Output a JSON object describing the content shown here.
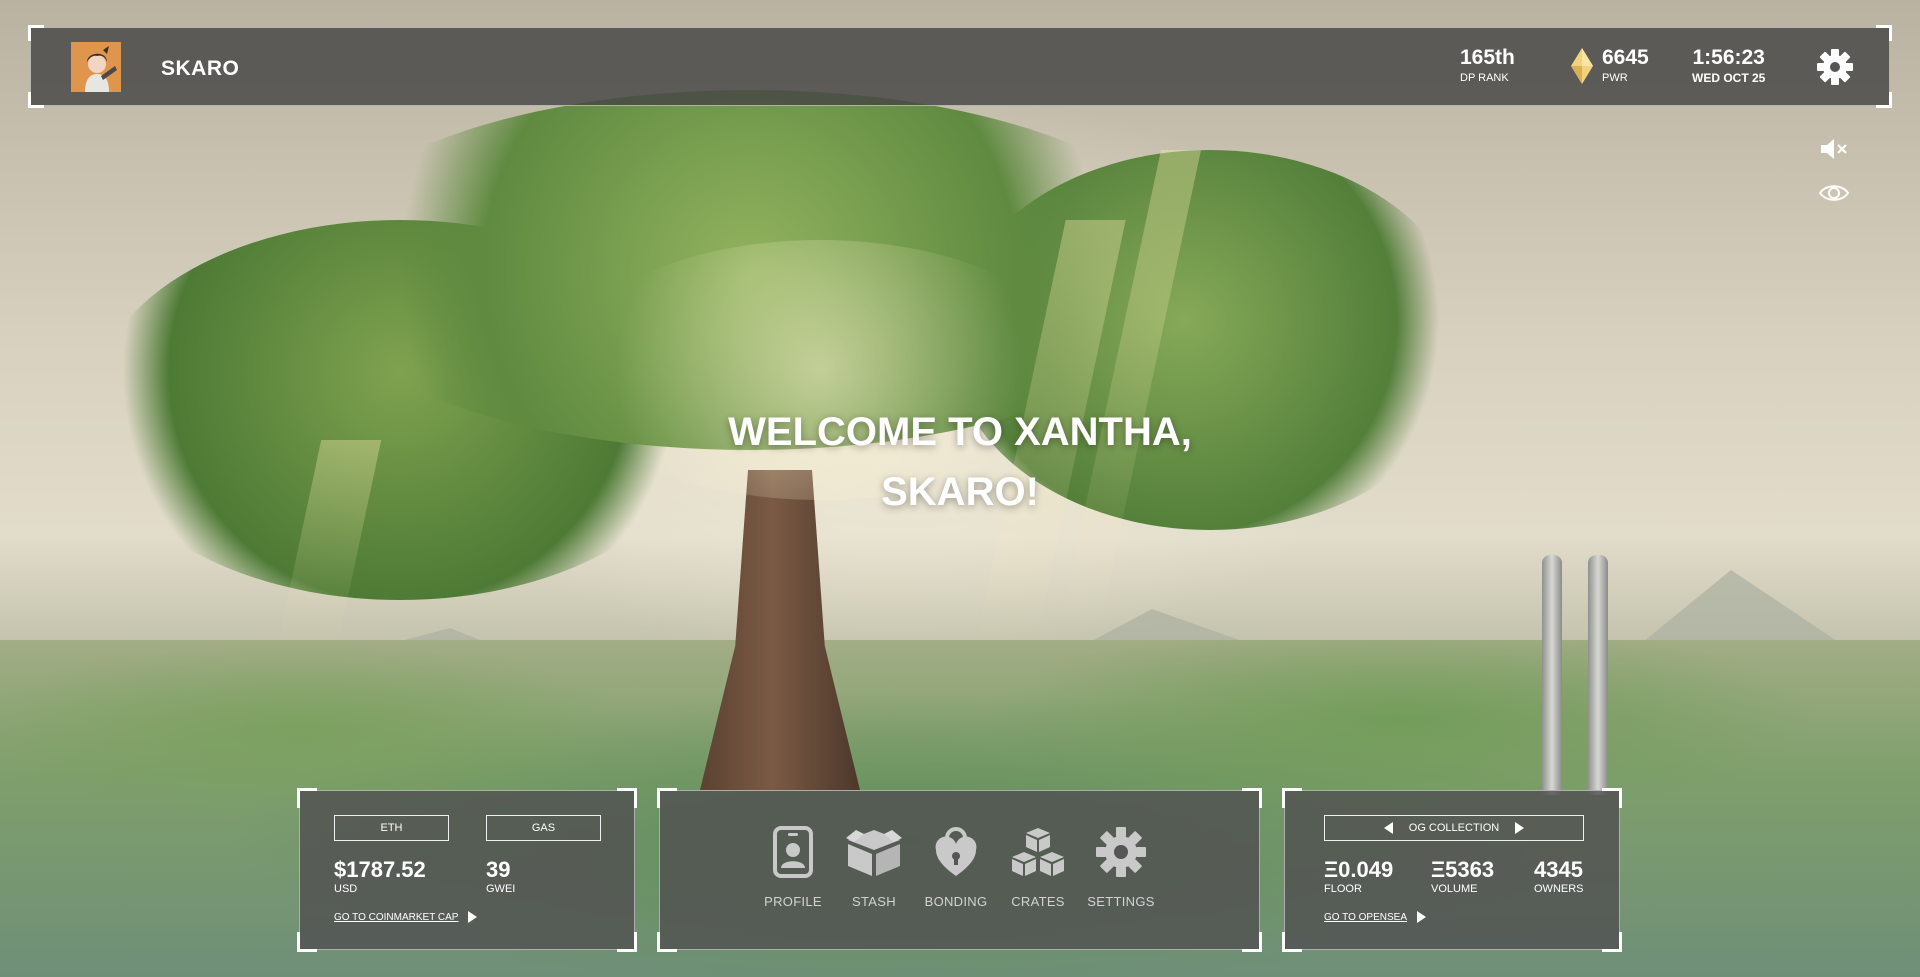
{
  "user": {
    "name": "SKARO"
  },
  "stats": {
    "rank_value": "165th",
    "rank_label": "DP RANK",
    "pwr_value": "6645",
    "pwr_label": "PWR",
    "time": "1:56:23",
    "date": "WED OCT 25"
  },
  "welcome": {
    "line1": "WELCOME TO XANTHA,",
    "line2": "SKARO!"
  },
  "eth_panel": {
    "tab_eth": "ETH",
    "tab_gas": "GAS",
    "eth_value": "$1787.52",
    "eth_unit": "USD",
    "gas_value": "39",
    "gas_unit": "GWEI",
    "link": "GO TO COINMARKET CAP"
  },
  "nav": {
    "items": [
      {
        "label": "PROFILE",
        "icon": "profile-icon"
      },
      {
        "label": "STASH",
        "icon": "box-icon"
      },
      {
        "label": "BONDING",
        "icon": "heart-lock-icon"
      },
      {
        "label": "CRATES",
        "icon": "crates-icon"
      },
      {
        "label": "SETTINGS",
        "icon": "gear-icon"
      }
    ]
  },
  "collection_panel": {
    "collection_name": "OG COLLECTION",
    "floor_value": "Ξ0.049",
    "floor_label": "FLOOR",
    "volume_value": "Ξ5363",
    "volume_label": "VOLUME",
    "owners_value": "4345",
    "owners_label": "OWNERS",
    "link": "GO TO OPENSEA"
  },
  "colors": {
    "panel_bg": "#505050",
    "gem": "#f2d27a",
    "avatar_bg": "#e0954d",
    "nav_icon": "#c9c9c9"
  }
}
